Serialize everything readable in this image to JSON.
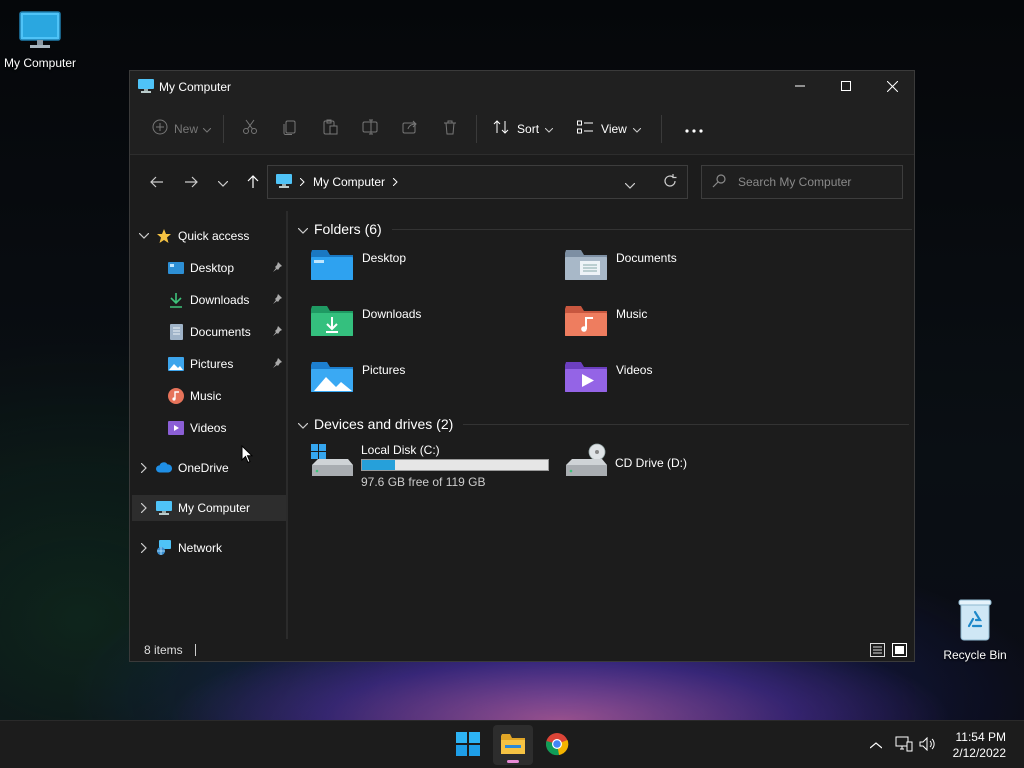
{
  "desktop": {
    "icons": [
      {
        "label": "My Computer"
      },
      {
        "label": "Recycle Bin"
      }
    ]
  },
  "window": {
    "title": "My Computer",
    "toolbar": {
      "new_label": "New",
      "sort_label": "Sort",
      "view_label": "View"
    },
    "address": {
      "crumb": "My Computer"
    },
    "search": {
      "placeholder": "Search My Computer"
    },
    "sidebar": {
      "items": [
        {
          "label": "Quick access"
        },
        {
          "label": "Desktop"
        },
        {
          "label": "Downloads"
        },
        {
          "label": "Documents"
        },
        {
          "label": "Pictures"
        },
        {
          "label": "Music"
        },
        {
          "label": "Videos"
        },
        {
          "label": "OneDrive"
        },
        {
          "label": "My Computer"
        },
        {
          "label": "Network"
        }
      ]
    },
    "content": {
      "folders_header": "Folders (6)",
      "folders": [
        {
          "label": "Desktop"
        },
        {
          "label": "Documents"
        },
        {
          "label": "Downloads"
        },
        {
          "label": "Music"
        },
        {
          "label": "Pictures"
        },
        {
          "label": "Videos"
        }
      ],
      "drives_header": "Devices and drives (2)",
      "drives": [
        {
          "label": "Local Disk (C:)",
          "free_text": "97.6 GB free of 119 GB",
          "used_fraction": 0.18
        },
        {
          "label": "CD Drive (D:)"
        }
      ]
    },
    "status": {
      "items_count": "8 items"
    }
  },
  "taskbar": {
    "apps": [
      "start-icon",
      "file-explorer-icon",
      "chrome-icon"
    ],
    "time": "11:54 PM",
    "date": "2/12/2022"
  },
  "colors": {
    "accent": "#26a0da",
    "window_bg": "#1c1c1c",
    "active_indicator": "#e98ad6"
  }
}
